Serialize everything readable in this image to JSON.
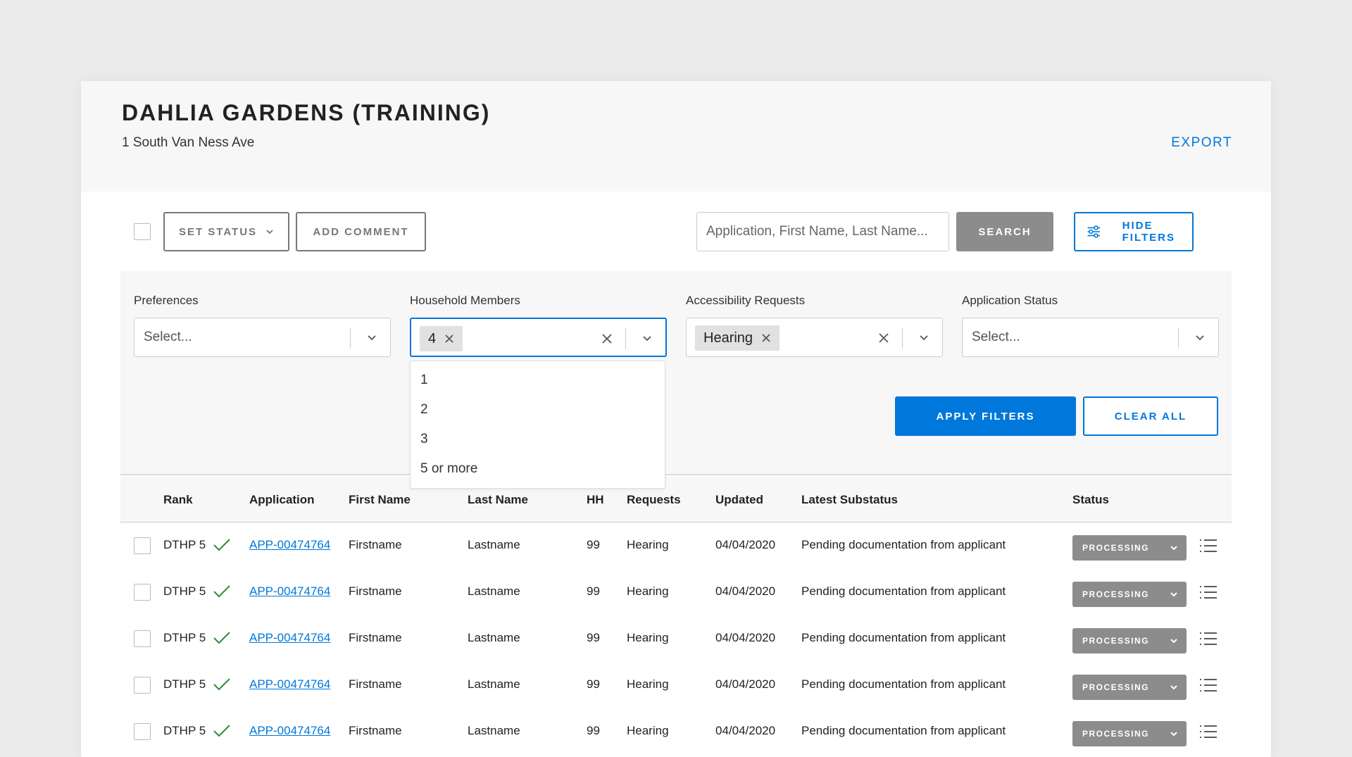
{
  "header": {
    "title": "DAHLIA GARDENS (TRAINING)",
    "address": "1 South Van Ness Ave",
    "export_label": "EXPORT"
  },
  "toolbar": {
    "set_status_label": "SET STATUS",
    "add_comment_label": "ADD COMMENT",
    "search_placeholder": "Application, First Name, Last Name...",
    "search_label": "SEARCH",
    "hide_filters_label": "HIDE FILTERS"
  },
  "filters": {
    "preferences": {
      "label": "Preferences",
      "placeholder": "Select..."
    },
    "household": {
      "label": "Household Members",
      "selected": "4",
      "options": [
        "1",
        "2",
        "3",
        "5 or more"
      ]
    },
    "accessibility": {
      "label": "Accessibility Requests",
      "selected": "Hearing"
    },
    "status": {
      "label": "Application Status",
      "placeholder": "Select..."
    },
    "apply_label": "APPLY FILTERS",
    "clear_label": "CLEAR ALL"
  },
  "table": {
    "headers": [
      "Rank",
      "Application",
      "First Name",
      "Last Name",
      "HH",
      "Requests",
      "Updated",
      "Latest Substatus",
      "Status"
    ],
    "rows": [
      {
        "rank": "DTHP 5",
        "application": "APP-00474764",
        "first_name": "Firstname",
        "last_name": "Lastname",
        "hh": "99",
        "requests": "Hearing",
        "updated": "04/04/2020",
        "substatus": "Pending documentation from applicant",
        "status": "PROCESSING"
      },
      {
        "rank": "DTHP 5",
        "application": "APP-00474764",
        "first_name": "Firstname",
        "last_name": "Lastname",
        "hh": "99",
        "requests": "Hearing",
        "updated": "04/04/2020",
        "substatus": "Pending documentation from applicant",
        "status": "PROCESSING"
      },
      {
        "rank": "DTHP 5",
        "application": "APP-00474764",
        "first_name": "Firstname",
        "last_name": "Lastname",
        "hh": "99",
        "requests": "Hearing",
        "updated": "04/04/2020",
        "substatus": "Pending documentation from applicant",
        "status": "PROCESSING"
      },
      {
        "rank": "DTHP 5",
        "application": "APP-00474764",
        "first_name": "Firstname",
        "last_name": "Lastname",
        "hh": "99",
        "requests": "Hearing",
        "updated": "04/04/2020",
        "substatus": "Pending documentation from applicant",
        "status": "PROCESSING"
      },
      {
        "rank": "DTHP 5",
        "application": "APP-00474764",
        "first_name": "Firstname",
        "last_name": "Lastname",
        "hh": "99",
        "requests": "Hearing",
        "updated": "04/04/2020",
        "substatus": "Pending documentation from applicant",
        "status": "PROCESSING"
      }
    ]
  },
  "colors": {
    "accent": "#0077da",
    "check_green": "#2e8b3a",
    "status_gray": "#8c8c8c",
    "background": "#ebebeb"
  },
  "icons": [
    "chevron-down-icon",
    "filter-sliders-icon",
    "close-icon",
    "checkmark-icon",
    "list-menu-icon"
  ]
}
